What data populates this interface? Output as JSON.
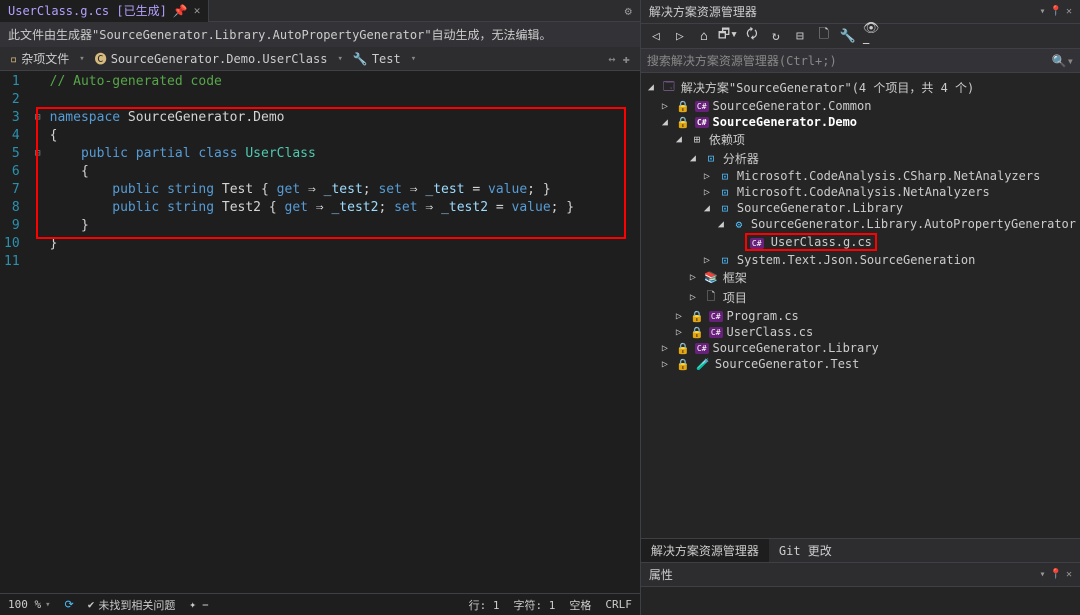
{
  "tab": {
    "title": "UserClass.g.cs [已生成]",
    "close": "✕"
  },
  "infoBar": {
    "text": "此文件由生成器\"SourceGenerator.Library.AutoPropertyGenerator\"自动生成，无法编辑。"
  },
  "breadcrumb": {
    "item1": "杂项文件",
    "item2": "SourceGenerator.Demo.UserClass",
    "item3": "Test"
  },
  "code": {
    "lines": [
      "1",
      "2",
      "3",
      "4",
      "5",
      "6",
      "7",
      "8",
      "9",
      "10",
      "11"
    ],
    "l1_comment": "// Auto-generated code",
    "l3_kw_ns": "namespace",
    "l3_ns": " SourceGenerator",
    "l3_dot": ".",
    "l3_demo": "Demo",
    "l4": "{",
    "l5_pub": "public",
    "l5_partial": " partial",
    "l5_class": " class",
    "l5_name": " UserClass",
    "l6": "    {",
    "l7_pub": "public",
    "l7_string": " string",
    "l7_name": " Test ",
    "l7_open": "{ ",
    "l7_get": "get",
    "l7_arr": " ⇒ ",
    "l7_f1": "_test",
    "l7_semi": "; ",
    "l7_set": "set",
    "l7_arr2": " ⇒ ",
    "l7_f2": "_test",
    "l7_eq": " = ",
    "l7_val": "value",
    "l7_end": "; }",
    "l8_pub": "public",
    "l8_string": " string",
    "l8_name": " Test2 ",
    "l8_open": "{ ",
    "l8_get": "get",
    "l8_arr": " ⇒ ",
    "l8_f1": "_test2",
    "l8_semi": "; ",
    "l8_set": "set",
    "l8_arr2": " ⇒ ",
    "l8_f2": "_test2",
    "l8_eq": " = ",
    "l8_val": "value",
    "l8_end": "; }",
    "l9": "    }",
    "l10": "}"
  },
  "status": {
    "zoom": "100 %",
    "noIssues": "未找到相关问题",
    "line": "行: 1",
    "char": "字符: 1",
    "space": "空格",
    "crlf": "CRLF"
  },
  "solutionExplorer": {
    "title": "解决方案资源管理器",
    "searchPlaceholder": "搜索解决方案资源管理器(Ctrl+;)",
    "root": "解决方案\"SourceGenerator\"(4 个项目，共 4 个)",
    "nodes": {
      "common": "SourceGenerator.Common",
      "demo": "SourceGenerator.Demo",
      "deps": "依赖项",
      "analyzers": "分析器",
      "netCSharp": "Microsoft.CodeAnalysis.CSharp.NetAnalyzers",
      "netAnalyzers": "Microsoft.CodeAnalysis.NetAnalyzers",
      "sgLibrary": "SourceGenerator.Library",
      "autoProp": "SourceGenerator.Library.AutoPropertyGenerator",
      "userClassG": "UserClass.g.cs",
      "jsonGen": "System.Text.Json.SourceGeneration",
      "frameworks": "框架",
      "projects": "项目",
      "program": "Program.cs",
      "userClass": "UserClass.cs",
      "libraryProj": "SourceGenerator.Library",
      "testProj": "SourceGenerator.Test"
    }
  },
  "bottomTabs": {
    "t1": "解决方案资源管理器",
    "t2": "Git 更改"
  },
  "props": {
    "title": "属性"
  }
}
